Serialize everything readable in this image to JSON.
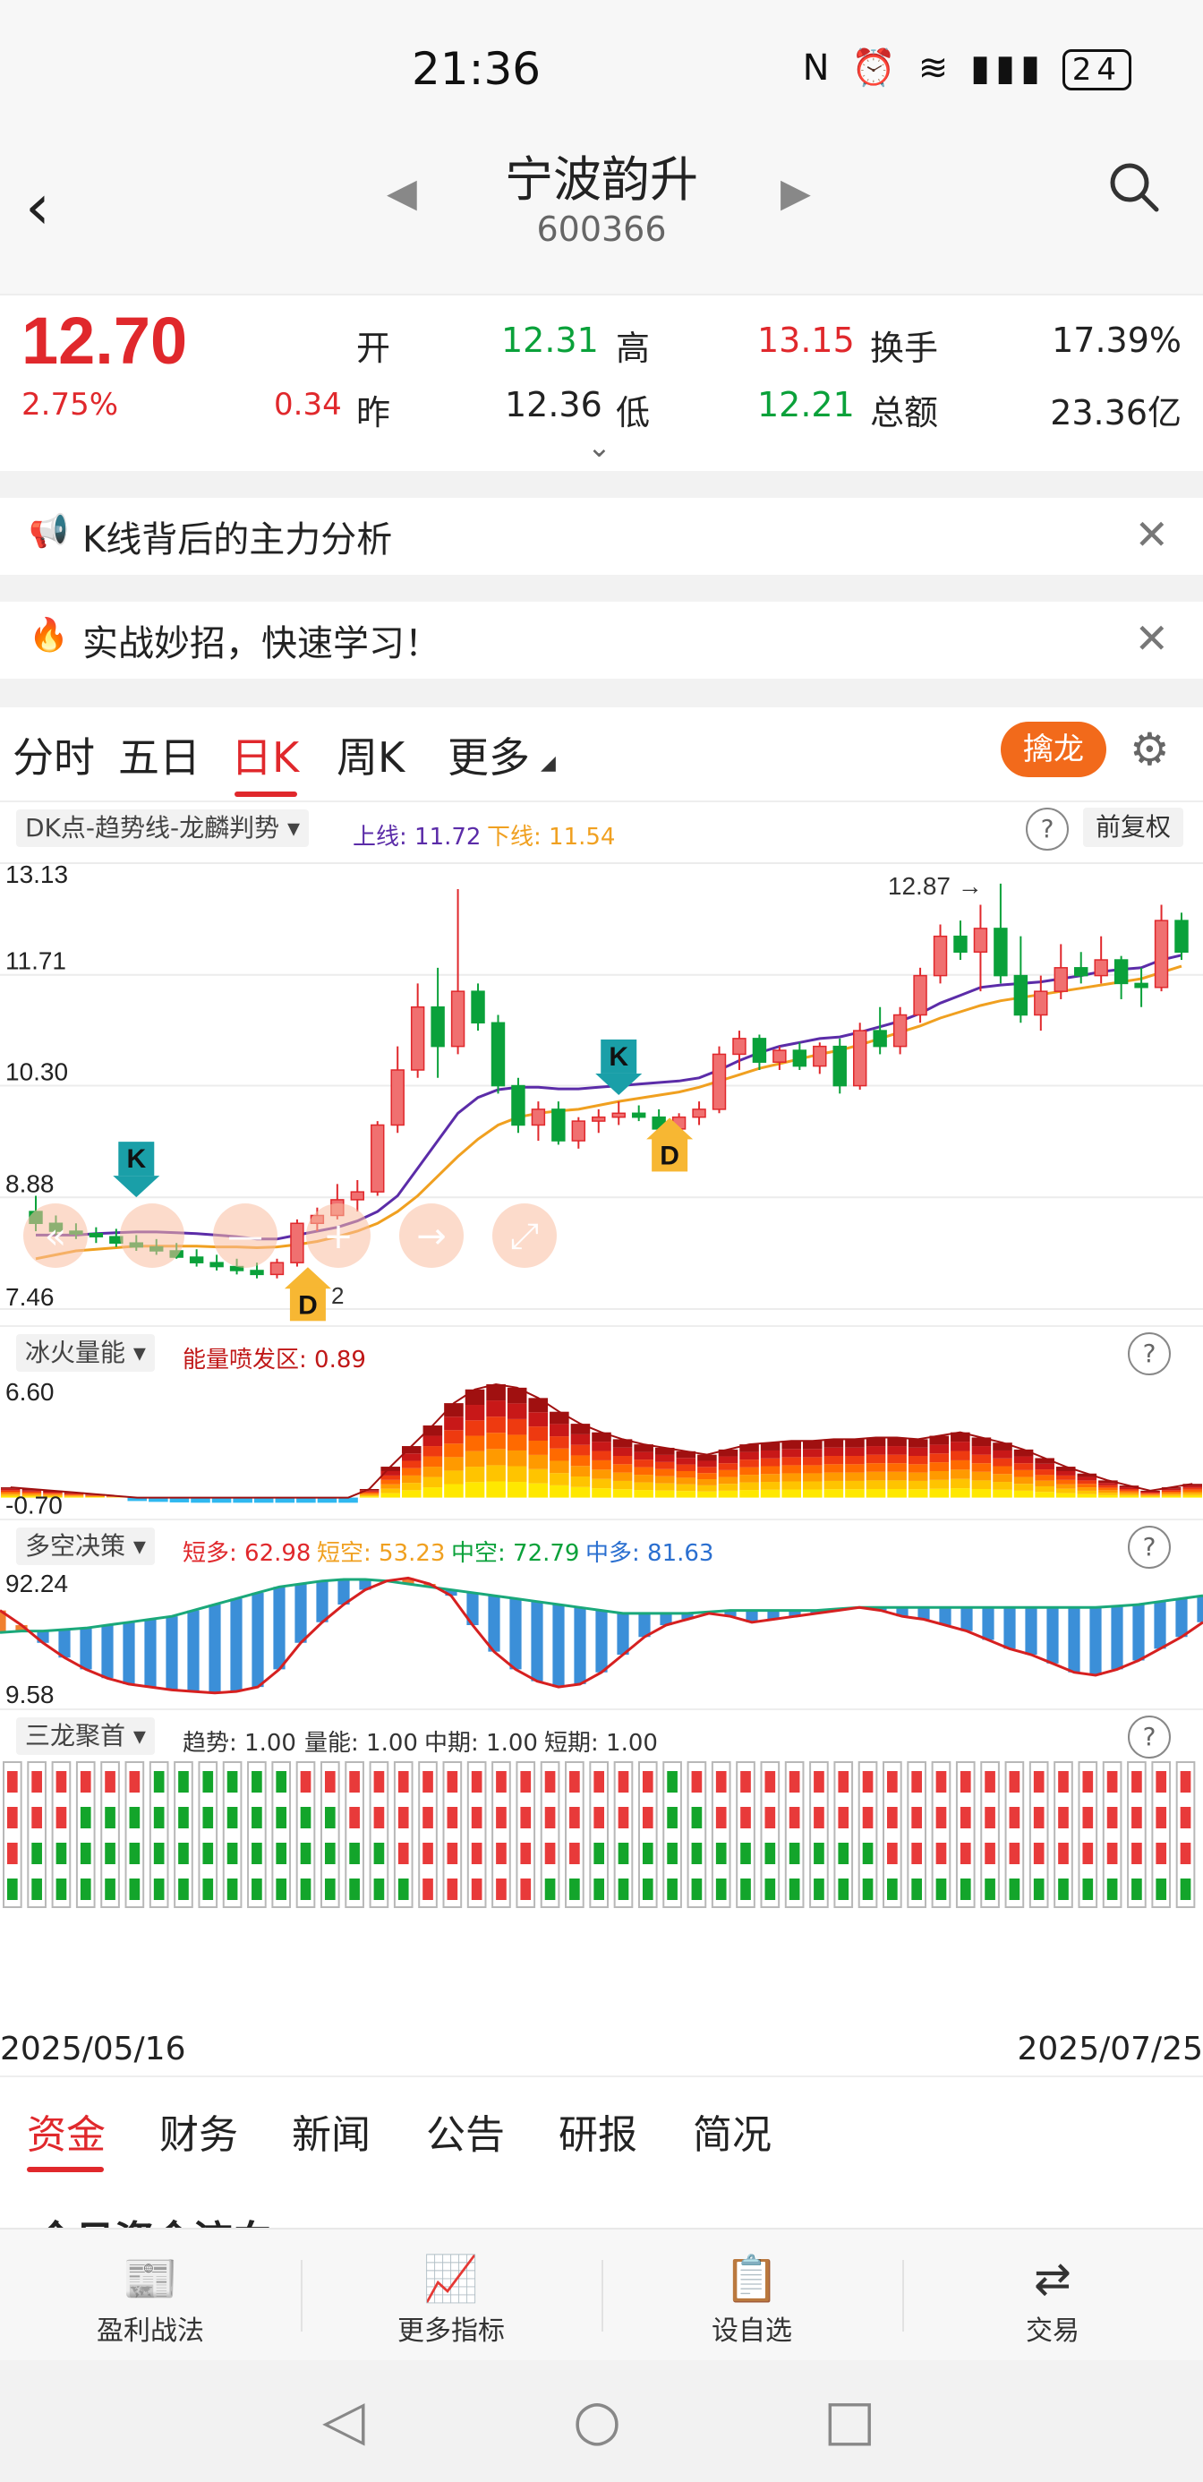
{
  "status": {
    "time": "21:36",
    "icons_text": "N ⏰ 📶 5G ▮▮ 24 ⚡",
    "battery": "24"
  },
  "header": {
    "back": "‹",
    "name": "宁波韵升",
    "code": "600366",
    "prev": "◀",
    "next": "▶"
  },
  "quote": {
    "price": "12.70",
    "pct": "2.75%",
    "change": "0.34",
    "open_label": "开",
    "open": "12.31",
    "high_label": "高",
    "high": "13.15",
    "prev_label": "昨",
    "prev": "12.36",
    "low_label": "低",
    "low": "12.21",
    "turnover_label": "换手",
    "turnover": "17.39%",
    "amount_label": "总额",
    "amount": "23.36亿",
    "expand": "⌄"
  },
  "banners": [
    {
      "icon": "📢",
      "text": "K线背后的主力分析",
      "close": "✕"
    },
    {
      "icon": "🔥",
      "text": "实战妙招，快速学习！",
      "close": "✕"
    }
  ],
  "tabs": {
    "items": [
      "分时",
      "五日",
      "日K",
      "周K",
      "更多"
    ],
    "qinlong": "擒龙",
    "gear": "⚙"
  },
  "indicator1": {
    "name": "DK点-趋势线-龙麟判势 ▾",
    "upper": "上线: 11.72",
    "lower": "下线: 11.54",
    "help": "?",
    "adjust": "前复权"
  },
  "chart_data": {
    "type": "candlestick",
    "y_ticks": [
      "13.13",
      "11.71",
      "10.30",
      "8.88",
      "7.46"
    ],
    "ylim": [
      7.46,
      13.13
    ],
    "max_label": "12.87 →",
    "min_label": "2",
    "marker_labels": [
      "K",
      "K",
      "D",
      "D"
    ],
    "candles": [
      {
        "o": 8.7,
        "h": 8.9,
        "l": 8.45,
        "c": 8.55
      },
      {
        "o": 8.55,
        "h": 8.65,
        "l": 8.4,
        "c": 8.45
      },
      {
        "o": 8.45,
        "h": 8.55,
        "l": 8.35,
        "c": 8.42
      },
      {
        "o": 8.42,
        "h": 8.5,
        "l": 8.3,
        "c": 8.38
      },
      {
        "o": 8.38,
        "h": 8.48,
        "l": 8.25,
        "c": 8.3
      },
      {
        "o": 8.3,
        "h": 8.4,
        "l": 8.2,
        "c": 8.25
      },
      {
        "o": 8.25,
        "h": 8.35,
        "l": 8.15,
        "c": 8.2
      },
      {
        "o": 8.2,
        "h": 8.3,
        "l": 8.1,
        "c": 8.12
      },
      {
        "o": 8.12,
        "h": 8.22,
        "l": 8.0,
        "c": 8.05
      },
      {
        "o": 8.05,
        "h": 8.15,
        "l": 7.95,
        "c": 8.0
      },
      {
        "o": 8.0,
        "h": 8.1,
        "l": 7.9,
        "c": 7.95
      },
      {
        "o": 7.95,
        "h": 8.05,
        "l": 7.85,
        "c": 7.9
      },
      {
        "o": 7.9,
        "h": 8.1,
        "l": 7.85,
        "c": 8.05
      },
      {
        "o": 8.05,
        "h": 8.6,
        "l": 8.0,
        "c": 8.55
      },
      {
        "o": 8.55,
        "h": 8.75,
        "l": 8.45,
        "c": 8.65
      },
      {
        "o": 8.65,
        "h": 9.05,
        "l": 8.6,
        "c": 8.85
      },
      {
        "o": 8.85,
        "h": 9.1,
        "l": 8.7,
        "c": 8.95
      },
      {
        "o": 8.95,
        "h": 9.85,
        "l": 8.9,
        "c": 9.8
      },
      {
        "o": 9.8,
        "h": 10.8,
        "l": 9.7,
        "c": 10.5
      },
      {
        "o": 10.5,
        "h": 11.6,
        "l": 10.4,
        "c": 11.3
      },
      {
        "o": 11.3,
        "h": 11.8,
        "l": 10.4,
        "c": 10.8
      },
      {
        "o": 10.8,
        "h": 12.8,
        "l": 10.7,
        "c": 11.5
      },
      {
        "o": 11.5,
        "h": 11.6,
        "l": 11.0,
        "c": 11.1
      },
      {
        "o": 11.1,
        "h": 11.2,
        "l": 10.2,
        "c": 10.3
      },
      {
        "o": 10.3,
        "h": 10.4,
        "l": 9.7,
        "c": 9.8
      },
      {
        "o": 9.8,
        "h": 10.1,
        "l": 9.6,
        "c": 10.0
      },
      {
        "o": 10.0,
        "h": 10.1,
        "l": 9.55,
        "c": 9.6
      },
      {
        "o": 9.6,
        "h": 9.9,
        "l": 9.5,
        "c": 9.85
      },
      {
        "o": 9.85,
        "h": 10.0,
        "l": 9.7,
        "c": 9.9
      },
      {
        "o": 9.9,
        "h": 10.1,
        "l": 9.8,
        "c": 9.95
      },
      {
        "o": 9.95,
        "h": 10.05,
        "l": 9.85,
        "c": 9.9
      },
      {
        "o": 9.9,
        "h": 10.0,
        "l": 9.7,
        "c": 9.75
      },
      {
        "o": 9.75,
        "h": 9.95,
        "l": 9.7,
        "c": 9.9
      },
      {
        "o": 9.9,
        "h": 10.1,
        "l": 9.8,
        "c": 10.0
      },
      {
        "o": 10.0,
        "h": 10.8,
        "l": 9.95,
        "c": 10.7
      },
      {
        "o": 10.7,
        "h": 11.0,
        "l": 10.5,
        "c": 10.9
      },
      {
        "o": 10.9,
        "h": 10.95,
        "l": 10.5,
        "c": 10.6
      },
      {
        "o": 10.6,
        "h": 10.8,
        "l": 10.5,
        "c": 10.75
      },
      {
        "o": 10.75,
        "h": 10.85,
        "l": 10.5,
        "c": 10.55
      },
      {
        "o": 10.55,
        "h": 10.85,
        "l": 10.45,
        "c": 10.8
      },
      {
        "o": 10.8,
        "h": 10.9,
        "l": 10.2,
        "c": 10.3
      },
      {
        "o": 10.3,
        "h": 11.1,
        "l": 10.25,
        "c": 11.0
      },
      {
        "o": 11.0,
        "h": 11.3,
        "l": 10.7,
        "c": 10.8
      },
      {
        "o": 10.8,
        "h": 11.3,
        "l": 10.7,
        "c": 11.2
      },
      {
        "o": 11.2,
        "h": 11.8,
        "l": 11.1,
        "c": 11.7
      },
      {
        "o": 11.7,
        "h": 12.35,
        "l": 11.6,
        "c": 12.2
      },
      {
        "o": 12.2,
        "h": 12.4,
        "l": 11.9,
        "c": 12.0
      },
      {
        "o": 12.0,
        "h": 12.6,
        "l": 11.5,
        "c": 12.3
      },
      {
        "o": 12.3,
        "h": 12.87,
        "l": 11.6,
        "c": 11.7
      },
      {
        "o": 11.7,
        "h": 12.2,
        "l": 11.1,
        "c": 11.2
      },
      {
        "o": 11.2,
        "h": 11.7,
        "l": 11.0,
        "c": 11.5
      },
      {
        "o": 11.5,
        "h": 12.1,
        "l": 11.4,
        "c": 11.8
      },
      {
        "o": 11.8,
        "h": 12.0,
        "l": 11.6,
        "c": 11.7
      },
      {
        "o": 11.7,
        "h": 12.2,
        "l": 11.6,
        "c": 11.9
      },
      {
        "o": 11.9,
        "h": 11.95,
        "l": 11.4,
        "c": 11.6
      },
      {
        "o": 11.6,
        "h": 11.8,
        "l": 11.3,
        "c": 11.55
      },
      {
        "o": 11.55,
        "h": 12.6,
        "l": 11.5,
        "c": 12.4
      },
      {
        "o": 12.4,
        "h": 12.5,
        "l": 11.9,
        "c": 12.0
      }
    ],
    "ma_upper": [
      8.4,
      8.4,
      8.4,
      8.42,
      8.43,
      8.44,
      8.44,
      8.43,
      8.42,
      8.4,
      8.38,
      8.35,
      8.35,
      8.4,
      8.45,
      8.5,
      8.58,
      8.7,
      8.9,
      9.25,
      9.6,
      9.95,
      10.15,
      10.25,
      10.28,
      10.28,
      10.26,
      10.26,
      10.28,
      10.3,
      10.32,
      10.34,
      10.36,
      10.4,
      10.5,
      10.62,
      10.72,
      10.8,
      10.85,
      10.9,
      10.92,
      10.98,
      11.05,
      11.12,
      11.22,
      11.35,
      11.45,
      11.55,
      11.58,
      11.6,
      11.62,
      11.66,
      11.7,
      11.75,
      11.78,
      11.8,
      11.9,
      11.96
    ],
    "ma_lower": [
      8.1,
      8.15,
      8.2,
      8.22,
      8.24,
      8.26,
      8.26,
      8.26,
      8.26,
      8.25,
      8.25,
      8.24,
      8.25,
      8.28,
      8.32,
      8.38,
      8.45,
      8.55,
      8.7,
      8.9,
      9.15,
      9.4,
      9.62,
      9.8,
      9.9,
      9.95,
      9.98,
      10.0,
      10.05,
      10.1,
      10.14,
      10.18,
      10.22,
      10.28,
      10.36,
      10.44,
      10.52,
      10.58,
      10.64,
      10.7,
      10.75,
      10.82,
      10.9,
      10.98,
      11.06,
      11.16,
      11.24,
      11.32,
      11.38,
      11.42,
      11.46,
      11.5,
      11.54,
      11.58,
      11.62,
      11.66,
      11.74,
      11.82
    ]
  },
  "indicator2": {
    "name": "冰火量能 ▾",
    "label": "能量喷发区: 0.89",
    "help": "?",
    "y_top": "6.60",
    "y_bottom": "-0.70",
    "values": [
      0.6,
      0.5,
      0.4,
      0.3,
      0.2,
      0.1,
      -0.2,
      -0.25,
      -0.28,
      -0.3,
      -0.3,
      -0.3,
      -0.3,
      -0.3,
      -0.3,
      -0.3,
      -0.3,
      0.5,
      1.8,
      3.0,
      4.2,
      5.5,
      6.3,
      6.6,
      6.4,
      5.8,
      5.0,
      4.3,
      3.8,
      3.4,
      3.1,
      2.9,
      2.7,
      2.5,
      2.8,
      3.1,
      3.2,
      3.3,
      3.3,
      3.4,
      3.4,
      3.5,
      3.5,
      3.4,
      3.6,
      3.8,
      3.5,
      3.2,
      2.8,
      2.3,
      1.8,
      1.4,
      1.0,
      0.7,
      0.4,
      0.6,
      0.8
    ]
  },
  "indicator3": {
    "name": "多空决策 ▾",
    "l1": "短多: 62.98",
    "l2": "短空: 53.23",
    "l3": "中空: 72.79",
    "l4": "中多: 81.63",
    "help": "?",
    "y_top": "92.24",
    "y_bottom": "9.58",
    "short": [
      70,
      60,
      48,
      38,
      30,
      24,
      20,
      18,
      16,
      15,
      14,
      15,
      18,
      30,
      48,
      62,
      74,
      84,
      90,
      92,
      88,
      80,
      60,
      42,
      30,
      22,
      18,
      20,
      28,
      40,
      52,
      60,
      64,
      68,
      66,
      62,
      64,
      66,
      68,
      70,
      72,
      70,
      66,
      64,
      60,
      56,
      50,
      44,
      40,
      34,
      28,
      26,
      30,
      36,
      44,
      52,
      62
    ],
    "mid": [
      55,
      56,
      56,
      57,
      58,
      60,
      62,
      64,
      66,
      70,
      74,
      78,
      82,
      86,
      88,
      90,
      91,
      91,
      90,
      88,
      86,
      84,
      82,
      80,
      78,
      76,
      74,
      72,
      70,
      68,
      68,
      68,
      68,
      69,
      70,
      70,
      70,
      70,
      70,
      71,
      72,
      72,
      72,
      72,
      72,
      72,
      72,
      72,
      72,
      72,
      72,
      72,
      73,
      74,
      76,
      78,
      80
    ]
  },
  "indicator4": {
    "name": "三龙聚首 ▾",
    "trend": "趋势: 1.00",
    "vol": "量能: 1.00",
    "mid": "中期: 1.00",
    "short": "短期: 1.00",
    "help": "?"
  },
  "dates": {
    "start": "2025/05/16",
    "end": "2025/07/25"
  },
  "bottom_tabs": [
    "资金",
    "财务",
    "新闻",
    "公告",
    "研报",
    "简况"
  ],
  "peek_text": "今日资金流向",
  "toolbar": [
    {
      "icon": "📰",
      "label": "盈利战法"
    },
    {
      "icon": "📈",
      "label": "更多指标"
    },
    {
      "icon": "📋",
      "label": "设自选"
    },
    {
      "icon": "⇄",
      "label": "交易"
    }
  ],
  "nav": {
    "back": "◁",
    "home": "○",
    "recent": "□"
  },
  "colors": {
    "up": "#e0282c",
    "down": "#0aa13a",
    "upper_ma": "#5b2ca8",
    "lower_ma": "#f0a020",
    "accent": "#f26a1b"
  }
}
